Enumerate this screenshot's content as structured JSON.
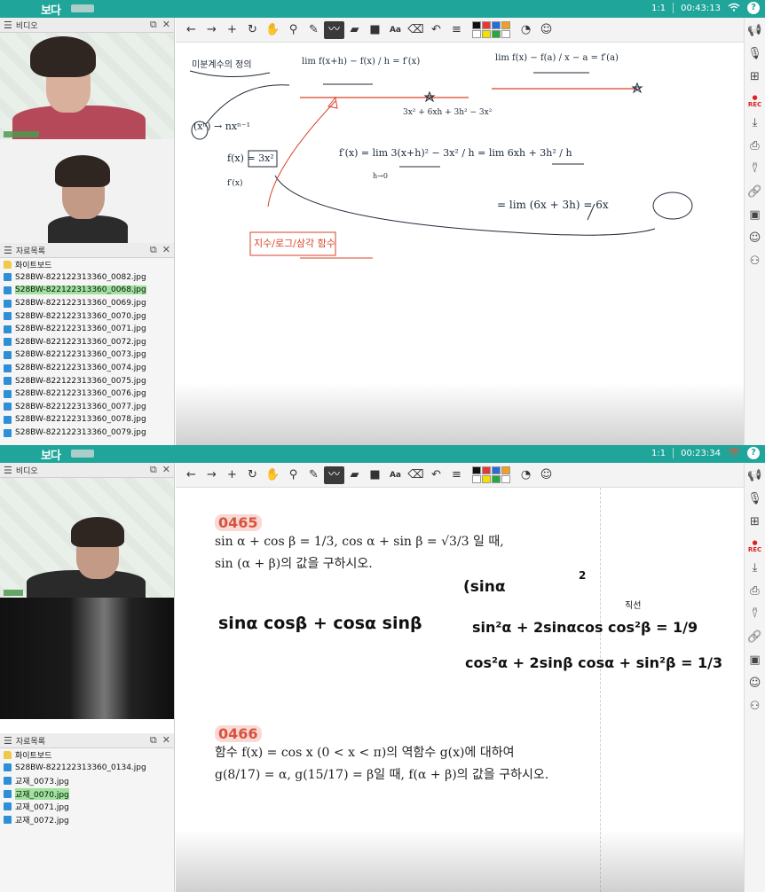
{
  "session1": {
    "app_brand": "보다",
    "ratio": "1:1",
    "time": "00:43:13",
    "video_panel_title": "비디오",
    "files_panel_title": "자료목록",
    "files": [
      {
        "name": "화이트보드",
        "type": "folder",
        "selected": false
      },
      {
        "name": "S28BW-822122313360_0082.jpg",
        "type": "image",
        "selected": false
      },
      {
        "name": "S28BW-822122313360_0068.jpg",
        "type": "image",
        "selected": true
      },
      {
        "name": "S28BW-822122313360_0069.jpg",
        "type": "image",
        "selected": false
      },
      {
        "name": "S28BW-822122313360_0070.jpg",
        "type": "image",
        "selected": false
      },
      {
        "name": "S28BW-822122313360_0071.jpg",
        "type": "image",
        "selected": false
      },
      {
        "name": "S28BW-822122313360_0072.jpg",
        "type": "image",
        "selected": false
      },
      {
        "name": "S28BW-822122313360_0073.jpg",
        "type": "image",
        "selected": false
      },
      {
        "name": "S28BW-822122313360_0074.jpg",
        "type": "image",
        "selected": false
      },
      {
        "name": "S28BW-822122313360_0075.jpg",
        "type": "image",
        "selected": false
      },
      {
        "name": "S28BW-822122313360_0076.jpg",
        "type": "image",
        "selected": false
      },
      {
        "name": "S28BW-822122313360_0077.jpg",
        "type": "image",
        "selected": false
      },
      {
        "name": "S28BW-822122313360_0078.jpg",
        "type": "image",
        "selected": false
      },
      {
        "name": "S28BW-822122313360_0079.jpg",
        "type": "image",
        "selected": false
      }
    ],
    "whiteboard": {
      "title": "미분계수의 정의",
      "def1": "lim  f(x+h) − f(x) / h  = f′(x)",
      "def2": "lim  f(x) − f(a) / x − a  = f′(a)",
      "expansion": "3x² + 6xh + 3h² − 3x²",
      "power_rule": "(xⁿ) → nxⁿ⁻¹",
      "fx": "f(x) = 3x²",
      "fpx": "f′(x)",
      "calc1": "f′(x) = lim  3(x+h)² − 3x² / h  =  lim  6xh + 3h² / h",
      "calc2": "= lim (6x + 3h) = 6x",
      "h_to_0": "h→0",
      "note": "지수/로그/삼각 함수"
    }
  },
  "session2": {
    "app_brand": "보다",
    "ratio": "1:1",
    "time": "00:23:34",
    "video_panel_title": "비디오",
    "files_panel_title": "자료목록",
    "files": [
      {
        "name": "화이트보드",
        "type": "folder",
        "selected": false
      },
      {
        "name": "S28BW-822122313360_0134.jpg",
        "type": "image",
        "selected": false
      },
      {
        "name": "교재_0073.jpg",
        "type": "image",
        "selected": false
      },
      {
        "name": "교재_0070.jpg",
        "type": "image",
        "selected": true
      },
      {
        "name": "교재_0071.jpg",
        "type": "image",
        "selected": false
      },
      {
        "name": "교재_0072.jpg",
        "type": "image",
        "selected": false
      }
    ],
    "problem1": {
      "number": "0465",
      "line1": "sin α + cos β = 1/3,  cos α + sin β = √3/3 일 때,",
      "line2": "sin (α + β)의 값을 구하시오."
    },
    "problem2": {
      "number": "0466",
      "line1": "함수 f(x) = cos x (0 < x < π)의 역함수 g(x)에 대하여",
      "line2": "g(8/17) = α, g(15/17) = β일 때, f(α + β)의 값을 구하시오."
    },
    "handwriting": {
      "h1": "sinα cosβ + cosα sinβ",
      "h2": "(sinα",
      "h3": "sin²α + 2sinαcos   cos²β = 1/9",
      "h4": "cos²α + 2sinβ cosα + sin²β = 1/3",
      "h5": "2",
      "h6": "직선"
    }
  },
  "toolbar_tools": [
    "arrow-left",
    "arrow-right",
    "plus",
    "rotate",
    "hand",
    "search",
    "pen",
    "highlighter-active",
    "marker",
    "square",
    "text",
    "eraser",
    "undo",
    "lines"
  ],
  "toolbar_text_tool": "Aa",
  "palette_colors": [
    "#111111",
    "#e53935",
    "#2a6cd6",
    "#f0a020",
    "#ffffff",
    "#f4e000",
    "#26a83c",
    "#ffffff"
  ],
  "right_tools": [
    "megaphone",
    "mic",
    "grid",
    "REC",
    "download",
    "print",
    "add-user",
    "link",
    "screen",
    "emoji",
    "group"
  ],
  "rec_label": "REC",
  "colors": {
    "brand": "#1fa59a",
    "ink": "#1d2a3a",
    "red_ink": "#d94024",
    "selected_file": "#9ee29c"
  }
}
